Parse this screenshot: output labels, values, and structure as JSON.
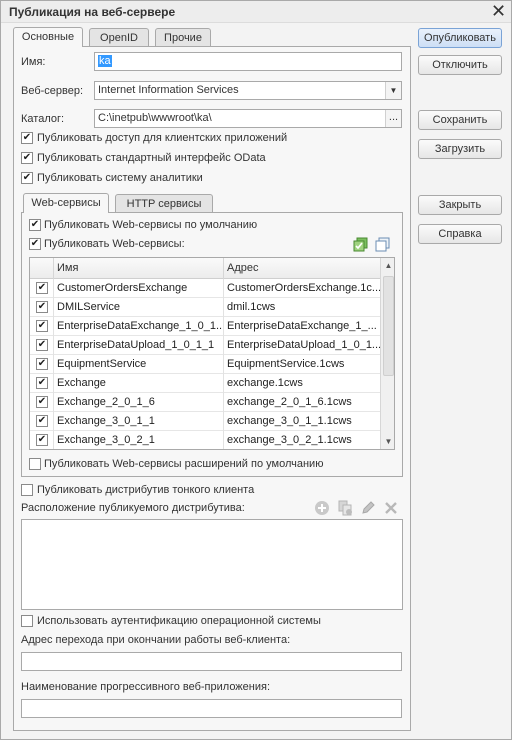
{
  "window": {
    "title": "Публикация на веб-сервере",
    "close_glyph": "✕"
  },
  "tabs": [
    "Основные",
    "OpenID",
    "Прочие"
  ],
  "fields": {
    "name_label": "Имя:",
    "name_value": "ka",
    "webserver_label": "Веб-сервер:",
    "webserver_value": "Internet Information Services",
    "catalog_label": "Каталог:",
    "catalog_value": "C:\\inetpub\\wwwroot\\ka\\",
    "catalog_button": "..."
  },
  "checkboxes": {
    "client_access": {
      "label": "Публиковать доступ для клиентских приложений",
      "checked": true
    },
    "odata": {
      "label": "Публиковать стандартный интерфейс OData",
      "checked": true
    },
    "analytics": {
      "label": "Публиковать систему аналитики",
      "checked": true
    },
    "ws_default": {
      "label": "Публиковать Web-сервисы по умолчанию",
      "checked": true
    },
    "ws_publish": {
      "label": "Публиковать Web-сервисы:",
      "checked": true
    },
    "ws_ext_default": {
      "label": "Публиковать Web-сервисы расширений по умолчанию",
      "checked": false
    },
    "thin_client": {
      "label": "Публиковать дистрибутив тонкого клиента",
      "checked": false
    },
    "os_auth": {
      "label": "Использовать аутентификацию операционной системы",
      "checked": false
    }
  },
  "inner_tabs": [
    "Web-сервисы",
    "HTTP сервисы"
  ],
  "grid": {
    "columns": [
      "Имя",
      "Адрес"
    ],
    "rows": [
      {
        "name": "CustomerOrdersExchange",
        "address": "CustomerOrdersExchange.1c...",
        "checked": true
      },
      {
        "name": "DMILService",
        "address": "dmil.1cws",
        "checked": true
      },
      {
        "name": "EnterpriseDataExchange_1_0_1...",
        "address": "EnterpriseDataExchange_1_...",
        "checked": true
      },
      {
        "name": "EnterpriseDataUpload_1_0_1_1",
        "address": "EnterpriseDataUpload_1_0_1...",
        "checked": true
      },
      {
        "name": "EquipmentService",
        "address": "EquipmentService.1cws",
        "checked": true
      },
      {
        "name": "Exchange",
        "address": "exchange.1cws",
        "checked": true
      },
      {
        "name": "Exchange_2_0_1_6",
        "address": "exchange_2_0_1_6.1cws",
        "checked": true
      },
      {
        "name": "Exchange_3_0_1_1",
        "address": "exchange_3_0_1_1.1cws",
        "checked": true
      },
      {
        "name": "Exchange_3_0_2_1",
        "address": "exchange_3_0_2_1.1cws",
        "checked": true
      }
    ]
  },
  "distrib_label": "Расположение публикуемого дистрибутива:",
  "exit_address_label": "Адрес перехода при окончании работы веб-клиента:",
  "pwa_name_label": "Наименование прогрессивного веб-приложения:",
  "buttons": {
    "publish": "Опубликовать",
    "disable": "Отключить",
    "save": "Сохранить",
    "load": "Загрузить",
    "close": "Закрыть",
    "help": "Справка"
  },
  "icons": [
    "check-all-icon",
    "uncheck-all-icon",
    "add-icon",
    "copy-icon",
    "edit-icon",
    "delete-icon"
  ],
  "colors": {
    "accent": "#7aa3d6",
    "selection": "#3399ff"
  }
}
